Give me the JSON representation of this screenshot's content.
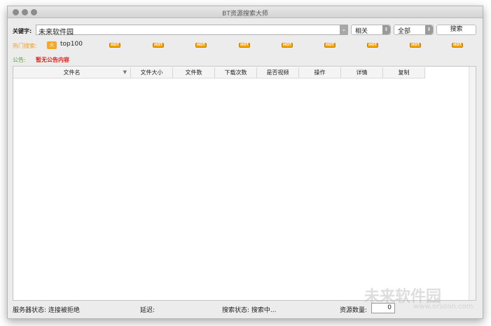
{
  "window": {
    "title": "BT资源搜索大师"
  },
  "search": {
    "label": "关键字:",
    "value": "未来软件园",
    "sort_select": "相关",
    "type_select": "全部",
    "button": "搜索"
  },
  "hot": {
    "label": "热门搜索:",
    "fire_icon_text": "火",
    "first": "top100",
    "badge": "HOT",
    "badge_count": 9
  },
  "notice": {
    "label": "公告:",
    "text": "暂无公告内容"
  },
  "table": {
    "columns": [
      "文件名",
      "文件大小",
      "文件数",
      "下载次数",
      "是否视频",
      "操作",
      "详情",
      "复制"
    ],
    "rows": []
  },
  "status": {
    "server_label": "服务器状态:",
    "server_value": "连接被拒绝",
    "latency_label": "延迟:",
    "search_label": "搜索状态:",
    "search_value": "搜索中...",
    "count_label": "资源数量:",
    "count_value": "0"
  },
  "watermark": {
    "text": "未来软件园",
    "url": "www.orsoon.com"
  }
}
